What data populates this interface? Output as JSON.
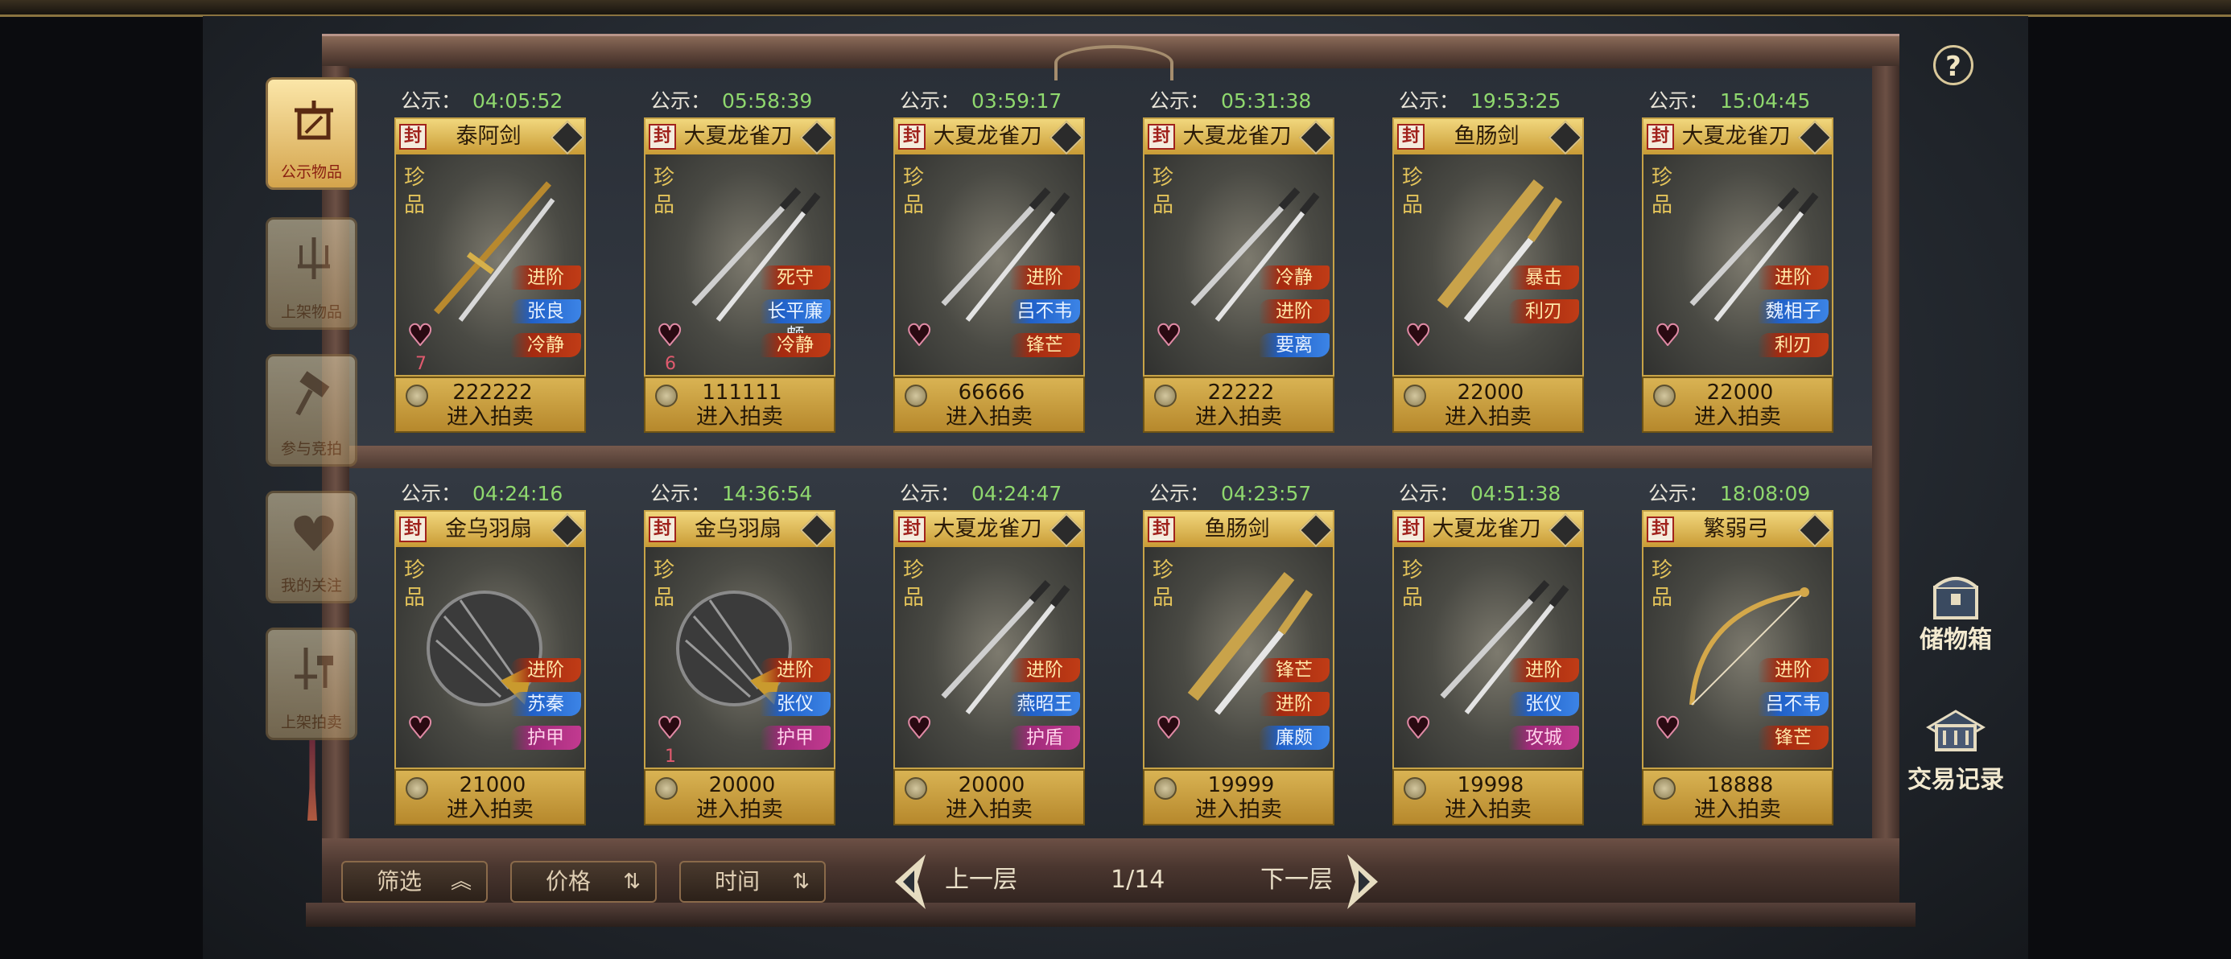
{
  "notice_label": "公示：",
  "seal_char": "封",
  "rare_label": "珍品",
  "enter_label": "进入拍卖",
  "side_tabs": [
    {
      "label": "公示物品",
      "icon": "notice-board-icon",
      "active": true
    },
    {
      "label": "上架物品",
      "icon": "weapon-rack-icon",
      "active": false
    },
    {
      "label": "参与竞拍",
      "icon": "auction-hammer-icon",
      "active": false
    },
    {
      "label": "我的关注",
      "icon": "heart-icon",
      "active": false
    },
    {
      "label": "上架拍卖",
      "icon": "weapon-hammer-icon",
      "active": false
    }
  ],
  "items": [
    {
      "timer": "04:05:52",
      "name": "泰阿剑",
      "weapon": "sword",
      "likes": "7",
      "price": "222222",
      "tags": [
        {
          "text": "进阶",
          "color": "red"
        },
        {
          "text": "张良",
          "color": "blue"
        },
        {
          "text": "冷静",
          "color": "red"
        }
      ]
    },
    {
      "timer": "05:58:39",
      "name": "大夏龙雀刀",
      "weapon": "dao",
      "likes": "6",
      "price": "111111",
      "tags": [
        {
          "text": "死守",
          "color": "red"
        },
        {
          "text": "长平廉颇",
          "color": "blue"
        },
        {
          "text": "冷静",
          "color": "red"
        }
      ]
    },
    {
      "timer": "03:59:17",
      "name": "大夏龙雀刀",
      "weapon": "dao",
      "likes": "",
      "price": "66666",
      "tags": [
        {
          "text": "进阶",
          "color": "red"
        },
        {
          "text": "吕不韦",
          "color": "blue"
        },
        {
          "text": "锋芒",
          "color": "red"
        }
      ]
    },
    {
      "timer": "05:31:38",
      "name": "大夏龙雀刀",
      "weapon": "dao",
      "likes": "",
      "price": "22222",
      "tags": [
        {
          "text": "冷静",
          "color": "red"
        },
        {
          "text": "进阶",
          "color": "red"
        },
        {
          "text": "要离",
          "color": "blue"
        }
      ]
    },
    {
      "timer": "19:53:25",
      "name": "鱼肠剑",
      "weapon": "dagger",
      "likes": "",
      "price": "22000",
      "tags": [
        {
          "text": "暴击",
          "color": "red"
        },
        {
          "text": "利刃",
          "color": "red"
        }
      ]
    },
    {
      "timer": "15:04:45",
      "name": "大夏龙雀刀",
      "weapon": "dao",
      "likes": "",
      "price": "22000",
      "tags": [
        {
          "text": "进阶",
          "color": "red"
        },
        {
          "text": "魏相子",
          "color": "blue"
        },
        {
          "text": "利刃",
          "color": "red"
        }
      ]
    },
    {
      "timer": "04:24:16",
      "name": "金乌羽扇",
      "weapon": "fan",
      "likes": "",
      "price": "21000",
      "tags": [
        {
          "text": "进阶",
          "color": "red"
        },
        {
          "text": "苏秦",
          "color": "blue"
        },
        {
          "text": "护甲",
          "color": "pink"
        }
      ]
    },
    {
      "timer": "14:36:54",
      "name": "金乌羽扇",
      "weapon": "fan",
      "likes": "1",
      "price": "20000",
      "tags": [
        {
          "text": "进阶",
          "color": "red"
        },
        {
          "text": "张仪",
          "color": "blue"
        },
        {
          "text": "护甲",
          "color": "pink"
        }
      ]
    },
    {
      "timer": "04:24:47",
      "name": "大夏龙雀刀",
      "weapon": "dao",
      "likes": "",
      "price": "20000",
      "tags": [
        {
          "text": "进阶",
          "color": "red"
        },
        {
          "text": "燕昭王",
          "color": "blue"
        },
        {
          "text": "护盾",
          "color": "pink"
        }
      ]
    },
    {
      "timer": "04:23:57",
      "name": "鱼肠剑",
      "weapon": "dagger",
      "likes": "",
      "price": "19999",
      "tags": [
        {
          "text": "锋芒",
          "color": "red"
        },
        {
          "text": "进阶",
          "color": "red"
        },
        {
          "text": "廉颇",
          "color": "blue"
        }
      ]
    },
    {
      "timer": "04:51:38",
      "name": "大夏龙雀刀",
      "weapon": "dao",
      "likes": "",
      "price": "19998",
      "tags": [
        {
          "text": "进阶",
          "color": "red"
        },
        {
          "text": "张仪",
          "color": "blue"
        },
        {
          "text": "攻城",
          "color": "pink"
        }
      ]
    },
    {
      "timer": "18:08:09",
      "name": "繁弱弓",
      "weapon": "bow",
      "likes": "",
      "price": "18888",
      "tags": [
        {
          "text": "进阶",
          "color": "red"
        },
        {
          "text": "吕不韦",
          "color": "blue"
        },
        {
          "text": "锋芒",
          "color": "red"
        }
      ]
    }
  ],
  "right_buttons": [
    {
      "label": "储物箱",
      "icon": "storage-chest-icon"
    },
    {
      "label": "交易记录",
      "icon": "trade-record-icon"
    }
  ],
  "help_label": "?",
  "filters": {
    "filter": "筛选",
    "price": "价格",
    "time": "时间"
  },
  "pager": {
    "prev": "上一层",
    "page": "1/14",
    "next": "下一层"
  }
}
